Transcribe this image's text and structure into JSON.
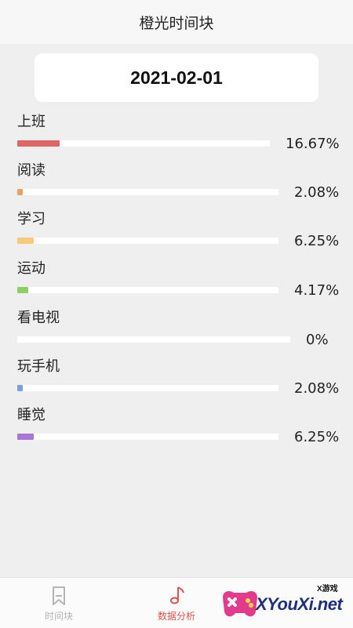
{
  "header": {
    "title": "橙光时间块"
  },
  "date": "2021-02-01",
  "items": [
    {
      "label": "上班",
      "percent": "16.67%",
      "value": 16.67,
      "color": "#e06666"
    },
    {
      "label": "阅读",
      "percent": "2.08%",
      "value": 2.08,
      "color": "#e8a066"
    },
    {
      "label": "学习",
      "percent": "6.25%",
      "value": 6.25,
      "color": "#f7c97a"
    },
    {
      "label": "运动",
      "percent": "4.17%",
      "value": 4.17,
      "color": "#8ccf62"
    },
    {
      "label": "看电视",
      "percent": "0%",
      "value": 0,
      "color": "#7fb8e0"
    },
    {
      "label": "玩手机",
      "percent": "2.08%",
      "value": 2.08,
      "color": "#7f9fd9"
    },
    {
      "label": "睡觉",
      "percent": "6.25%",
      "value": 6.25,
      "color": "#a877d6"
    }
  ],
  "tabbar": {
    "tabs": [
      {
        "label": "时间块",
        "icon": "bookmark-icon",
        "active": false
      },
      {
        "label": "数据分析",
        "icon": "music-note-icon",
        "active": true
      }
    ],
    "active_color": "#d9534f",
    "inactive_color": "#b5b5b5"
  },
  "watermark": {
    "brand": "XYouXi.net",
    "tag": "X游戏"
  }
}
